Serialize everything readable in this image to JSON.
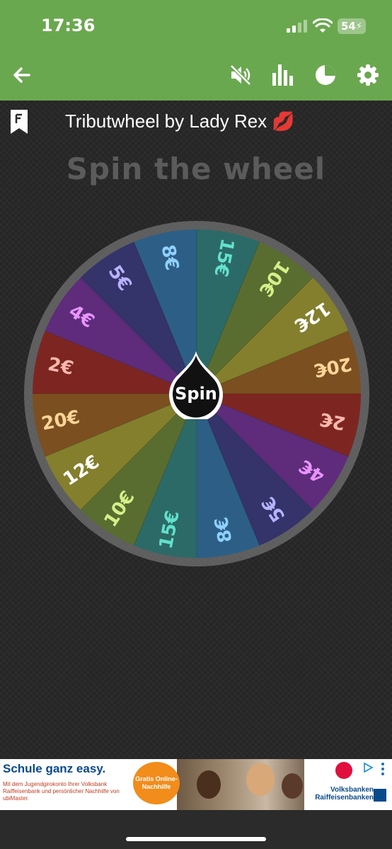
{
  "status_bar": {
    "time": "17:36",
    "battery": "54"
  },
  "toolbar": {
    "icons": [
      "back-arrow-icon",
      "mute-icon",
      "stats-icon",
      "pie-chart-icon",
      "settings-icon"
    ]
  },
  "wheel_title": "Tributwheel by Lady Rex 💋",
  "heading": "Spin the wheel",
  "spin_label": "Spin",
  "segments": [
    {
      "label": "8€",
      "color": "#2d5f86",
      "text_color": "#8fd0ff"
    },
    {
      "label": "15€",
      "color": "#2c6a67",
      "text_color": "#62e1cc"
    },
    {
      "label": "10€",
      "color": "#596d30",
      "text_color": "#d4f08a"
    },
    {
      "label": "12€",
      "color": "#837f2c",
      "text_color": "#ffffff"
    },
    {
      "label": "20€",
      "color": "#7b4f20",
      "text_color": "#ffd596"
    },
    {
      "label": "2€",
      "color": "#7d2621",
      "text_color": "#ffb8b0"
    },
    {
      "label": "4€",
      "color": "#5e2c7b",
      "text_color": "#e993ff"
    },
    {
      "label": "5€",
      "color": "#34336a",
      "text_color": "#b8b3ff"
    },
    {
      "label": "8€",
      "color": "#2d5f86",
      "text_color": "#8fd0ff"
    },
    {
      "label": "15€",
      "color": "#2c6a67",
      "text_color": "#62e1cc"
    },
    {
      "label": "10€",
      "color": "#596d30",
      "text_color": "#d4f08a"
    },
    {
      "label": "12€",
      "color": "#837f2c",
      "text_color": "#ffffff"
    },
    {
      "label": "20€",
      "color": "#7b4f20",
      "text_color": "#ffd596"
    },
    {
      "label": "2€",
      "color": "#7d2621",
      "text_color": "#ffb8b0"
    },
    {
      "label": "4€",
      "color": "#5e2c7b",
      "text_color": "#e993ff"
    },
    {
      "label": "5€",
      "color": "#34336a",
      "text_color": "#b8b3ff"
    }
  ],
  "ad": {
    "headline": "Schule ganz easy.",
    "body": "Mit dem Jugendgirokonto Ihrer Volksbank Raiffeisenbank und persönlicher Nachhilfe von ubiMaster.",
    "badge": "Gratis Online- Nachhilfe",
    "brand": "Volksbanken Raiffeisenbanken"
  }
}
